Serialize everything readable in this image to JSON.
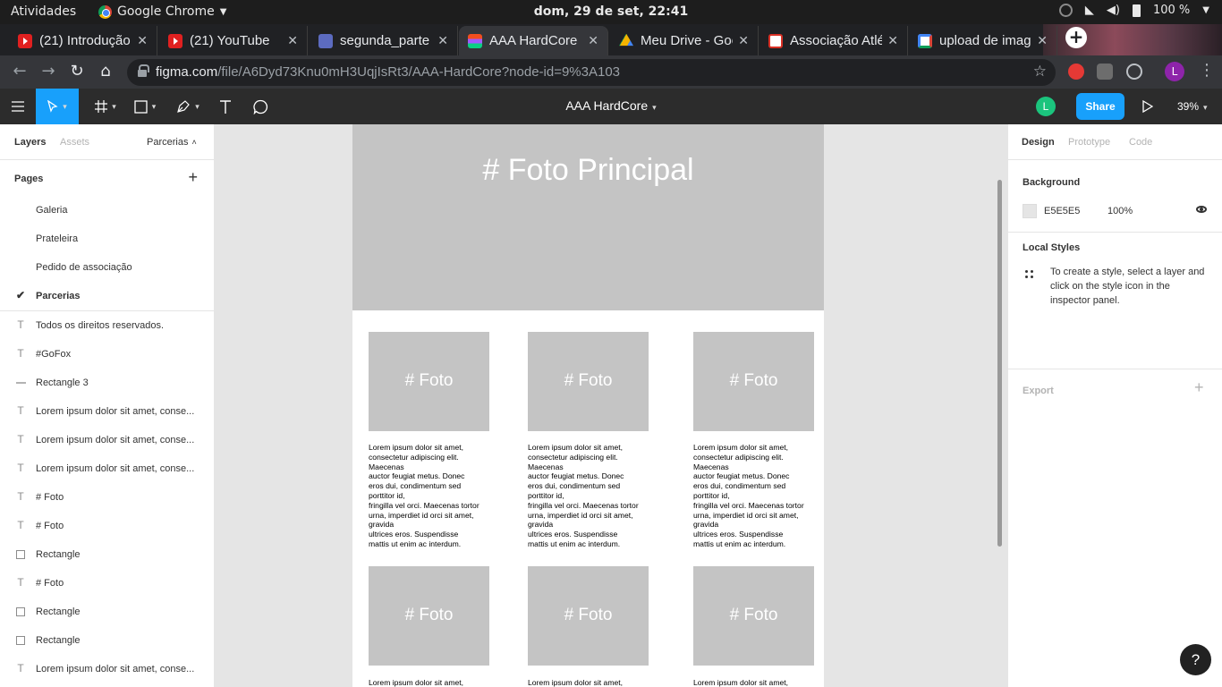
{
  "os": {
    "activities": "Atividades",
    "app_name": "Google Chrome",
    "clock": "dom, 29 de set, 22:41",
    "battery": "100 %"
  },
  "browser": {
    "tabs": [
      {
        "title": "(21) Introdução",
        "icon": "youtube-icon"
      },
      {
        "title": "(21) YouTube",
        "icon": "youtube-icon"
      },
      {
        "title": "segunda_parte",
        "icon": "google-docs-icon"
      },
      {
        "title": "AAA HardCore",
        "icon": "figma-icon"
      },
      {
        "title": "Meu Drive - Goo",
        "icon": "google-drive-icon"
      },
      {
        "title": "Associação Atlé",
        "icon": "gmail-icon"
      },
      {
        "title": "upload de imag",
        "icon": "google-icon"
      }
    ],
    "url_host": "figma.com",
    "url_path": "/file/A6Dyd73Knu0mH3UqjIsRt3/AAA-HardCore?node-id=9%3A103",
    "profile_initial": "L"
  },
  "figma": {
    "file_title": "AAA HardCore",
    "avatar_initial": "L",
    "share_label": "Share",
    "zoom": "39%",
    "left_tabs": {
      "layers": "Layers",
      "assets": "Assets",
      "current_page": "Parcerias"
    },
    "pages_label": "Pages",
    "pages": [
      "Galeria",
      "Prateleira",
      "Pedido de associação",
      "Parcerias"
    ],
    "layers": [
      {
        "type": "text",
        "label": "Todos os direitos reservados."
      },
      {
        "type": "text",
        "label": "#GoFox"
      },
      {
        "type": "line",
        "label": "Rectangle 3"
      },
      {
        "type": "text",
        "label": "Lorem ipsum dolor sit amet, conse..."
      },
      {
        "type": "text",
        "label": "Lorem ipsum dolor sit amet, conse..."
      },
      {
        "type": "text",
        "label": "Lorem ipsum dolor sit amet, conse..."
      },
      {
        "type": "text",
        "label": "# Foto"
      },
      {
        "type": "text",
        "label": "# Foto"
      },
      {
        "type": "rect",
        "label": "Rectangle"
      },
      {
        "type": "text",
        "label": "# Foto"
      },
      {
        "type": "rect",
        "label": "Rectangle"
      },
      {
        "type": "rect",
        "label": "Rectangle"
      },
      {
        "type": "text",
        "label": "Lorem ipsum dolor sit amet, conse..."
      }
    ],
    "right_tabs": {
      "design": "Design",
      "prototype": "Prototype",
      "code": "Code"
    },
    "background": {
      "label": "Background",
      "color": "E5E5E5",
      "opacity": "100%"
    },
    "local_styles": {
      "label": "Local Styles",
      "hint": "To create a style, select a layer and click on the style icon in the inspector panel."
    },
    "export_label": "Export",
    "help": "?"
  },
  "canvas": {
    "hero_text": "# Foto Principal",
    "photo_label": "# Foto",
    "lorem": "Lorem ipsum dolor sit amet,\nconsectetur adipiscing elit.\nMaecenas\nauctor feugiat metus. Donec\neros dui, condimentum sed\nporttitor id,\nfringilla vel orci. Maecenas tortor\nurna, imperdiet id orci sit amet,\ngravida\nultrices eros. Suspendisse\nmattis ut enim ac interdum.",
    "lorem_first_line": "Lorem ipsum dolor sit amet,"
  }
}
